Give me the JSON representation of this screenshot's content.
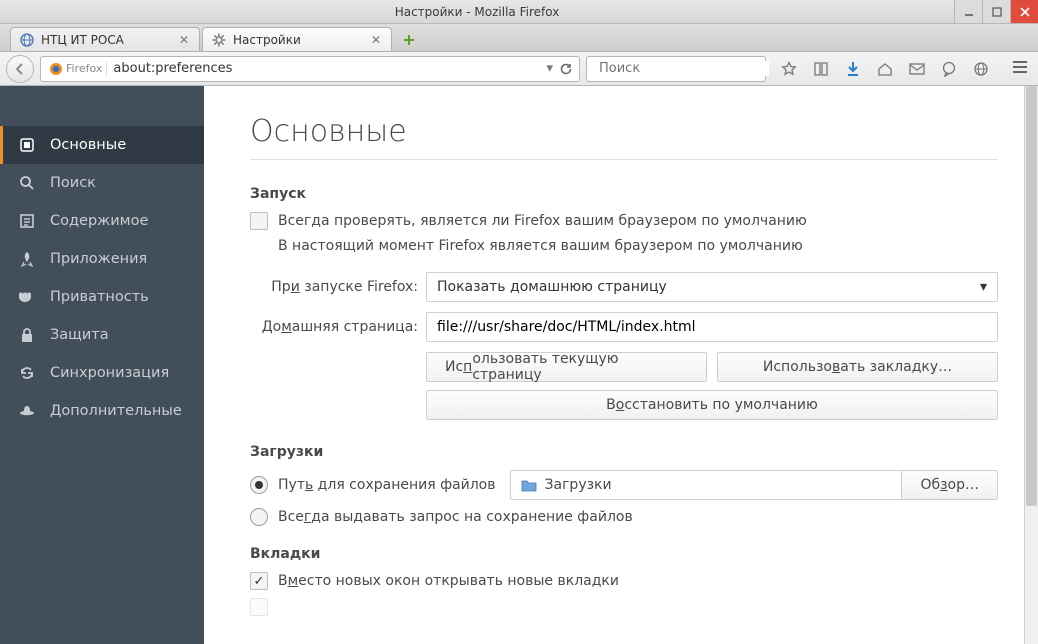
{
  "window": {
    "title": "Настройки - Mozilla Firefox"
  },
  "tabs": [
    {
      "label": "НТЦ ИТ РОСА",
      "active": false
    },
    {
      "label": "Настройки",
      "active": true
    }
  ],
  "url": {
    "identity": "Firefox",
    "value": "about:preferences"
  },
  "search": {
    "placeholder": "Поиск"
  },
  "sidebar": {
    "items": [
      {
        "label": "Основные",
        "icon": "general"
      },
      {
        "label": "Поиск",
        "icon": "search"
      },
      {
        "label": "Содержимое",
        "icon": "content"
      },
      {
        "label": "Приложения",
        "icon": "apps"
      },
      {
        "label": "Приватность",
        "icon": "privacy"
      },
      {
        "label": "Защита",
        "icon": "security"
      },
      {
        "label": "Синхронизация",
        "icon": "sync"
      },
      {
        "label": "Дополнительные",
        "icon": "adv"
      }
    ]
  },
  "page": {
    "title": "Основные",
    "startup": {
      "heading": "Запуск",
      "check_default_label": "Всегда проверять, является ли Firefox вашим браузером по умолчанию",
      "check_default_u": "д",
      "default_status": "В настоящий момент Firefox является вашим браузером по умолчанию",
      "on_start_label": "При запуске Firefox:",
      "on_start_u": "и",
      "on_start_value": "Показать домашнюю страницу",
      "home_label": "Домашняя страница:",
      "home_u": "м",
      "home_value": "file:///usr/share/doc/HTML/index.html",
      "use_current": "Использовать текущую страницу",
      "use_current_u": "п",
      "use_bookmark": "Использовать закладку…",
      "use_bookmark_u": "в",
      "restore_default": "Восстановить по умолчанию",
      "restore_default_u": "о"
    },
    "downloads": {
      "heading": "Загрузки",
      "save_to_label": "Путь для сохранения файлов",
      "save_to_u": "ь",
      "folder": "Загрузки",
      "browse": "Обзор…",
      "browse_u": "з",
      "ask_label": "Всегда выдавать запрос на сохранение файлов",
      "ask_u": "г"
    },
    "tabs_s": {
      "heading": "Вкладки",
      "new_windows_label": "Вместо новых окон открывать новые вкладки",
      "new_windows_u": "м"
    }
  }
}
